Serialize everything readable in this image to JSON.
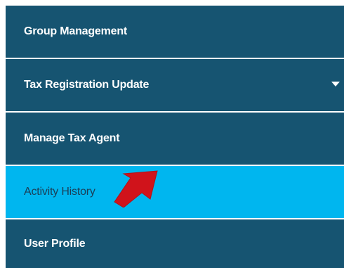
{
  "menu": {
    "items": [
      {
        "label": "Group Management",
        "active": false
      },
      {
        "label": "Tax Registration Update",
        "active": false,
        "has_dropdown": true,
        "dropdown_icon": "caret-down-icon"
      },
      {
        "label": "Manage Tax Agent",
        "active": false
      },
      {
        "label": "Activity History",
        "active": true
      },
      {
        "label": "User Profile",
        "active": false
      }
    ]
  },
  "annotation": {
    "icon": "red-arrow-icon",
    "color": "#d0131b"
  },
  "colors": {
    "item_background": "#165471",
    "active_background": "#00b6ef",
    "item_text": "#ffffff",
    "active_text": "#1b3f57"
  }
}
